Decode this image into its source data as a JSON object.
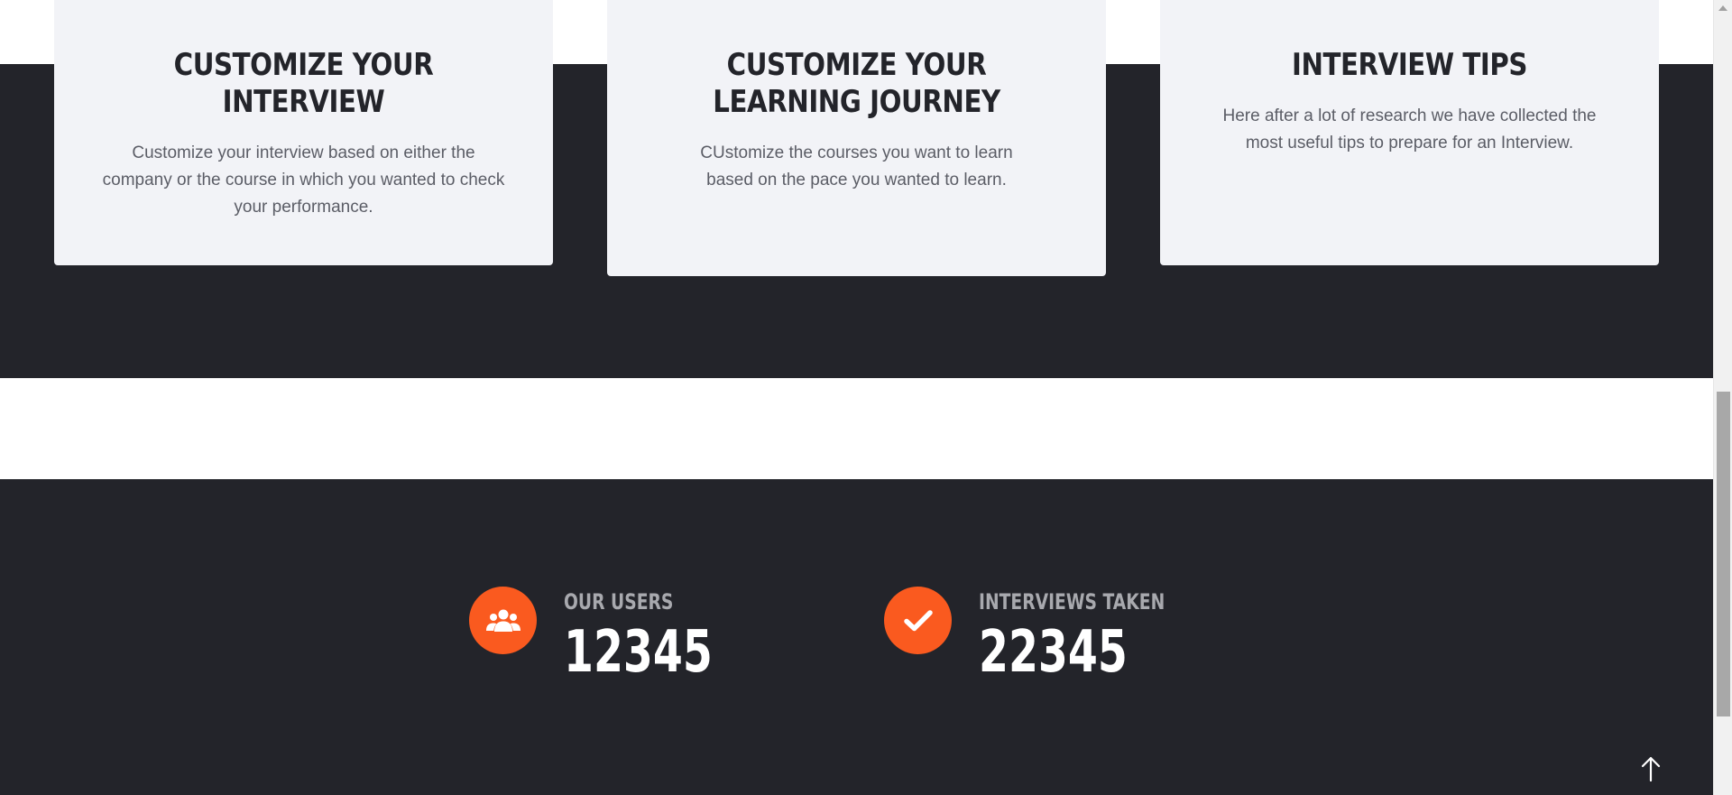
{
  "features": [
    {
      "title": "CUSTOMIZE YOUR INTERVIEW",
      "text": "Customize your interview based on either the company or the course in which you wanted to check your performance."
    },
    {
      "title": "CUSTOMIZE YOUR LEARNING JOURNEY",
      "text": "CUstomize the courses you want to learn based on the pace you wanted to learn."
    },
    {
      "title": "INTERVIEW TIPS",
      "text": "Here after a lot of research we have collected the most useful tips to prepare for an Interview."
    }
  ],
  "stats": [
    {
      "icon": "users-icon",
      "label": "OUR USERS",
      "value": "12345"
    },
    {
      "icon": "check-icon",
      "label": "INTERVIEWS TAKEN",
      "value": "22345"
    }
  ],
  "colors": {
    "dark_background": "#23242a",
    "card_background": "#f2f3f7",
    "accent": "#fa5a1f",
    "stat_label": "#a8a9ae",
    "card_text": "#5b5d66"
  },
  "scroll_top_icon": "arrow-up-icon"
}
